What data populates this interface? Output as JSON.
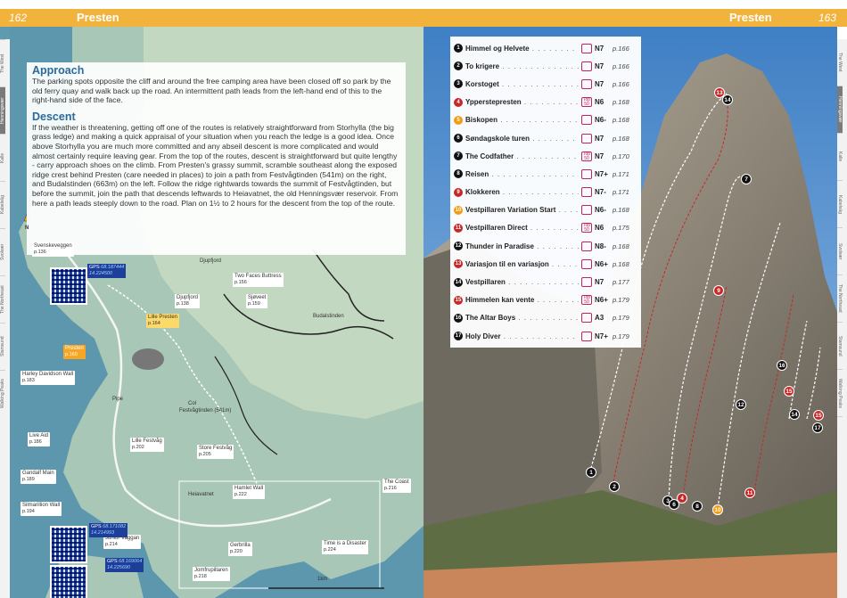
{
  "left": {
    "page_number": "162",
    "title": "Presten",
    "side_tabs": [
      "The West",
      "Henningsvær",
      "Kalle",
      "Kabelvåg",
      "Svolvær",
      "The Northeast",
      "Stamsund",
      "Walking Peaks"
    ],
    "active_tab": 1,
    "approach_heading": "Approach",
    "approach_text": "The parking spots opposite the cliff and around the free camping area have been closed off so park by the old ferry quay and walk back up the road. An intermittent path leads from the left-hand end of this to the right-hand side of the face.",
    "descent_heading": "Descent",
    "descent_text": "If the weather is threatening, getting off one of the routes is relatively straightforward from Storhylla (the big grass ledge) and making a quick appraisal of your situation when you reach the ledge is a good idea. Once above Storhylla you are much more committed and any abseil descent is more complicated and would almost certainly require leaving gear. From the top of the routes, descent is straightforward but quite lengthy - carry approach shoes on the climb. From Presten's grassy summit, scramble southeast along the exposed ridge crest behind Presten (care needed in places) to join a path from Festvågtinden (541m) on the right, and Budalstinden (663m) on the left. Follow the ridge rightwards towards the summit of Festvågtinden, but before the summit, join the path that descends leftwards to Heiavatnet, the old Henningsvær reservoir. From here a path leads steeply down to the road. Plan on 1½ to 2 hours for the descent from the top of the route.",
    "north": "N",
    "map_labels": [
      {
        "name": "Svenskeveggen",
        "page": "p.136"
      },
      {
        "name": "Two Faces Buttress",
        "page": "p.156"
      },
      {
        "name": "Sjøveet",
        "page": "p.159"
      },
      {
        "name": "Djupfjord",
        "page": "p.138"
      },
      {
        "name": "Lille Presten",
        "page": "p.164"
      },
      {
        "name": "Presten",
        "page": "p.160"
      },
      {
        "name": "Harley Davidson Wall",
        "page": "p.183"
      },
      {
        "name": "Live Aid",
        "page": "p.186"
      },
      {
        "name": "Lille Festvåg",
        "page": "p.202"
      },
      {
        "name": "Store Festvåg",
        "page": "p.205"
      },
      {
        "name": "Gandalf Main",
        "page": "p.189"
      },
      {
        "name": "Silmarillion Wall",
        "page": "p.194"
      },
      {
        "name": "Hamlet Wall",
        "page": "p.222"
      },
      {
        "name": "The Coast",
        "page": "p.216"
      },
      {
        "name": "Junior Vaggan",
        "page": "p.214"
      },
      {
        "name": "Gerbrilla",
        "page": "p.220"
      },
      {
        "name": "Jomfrupillaren",
        "page": "p.218"
      },
      {
        "name": "Time is a Disaster",
        "page": "p.224"
      }
    ],
    "plain_labels": [
      "Budalstinden",
      "Djupfjord",
      "Col",
      "Festvågtinden (541m)",
      "Pipe",
      "Heiavatnet"
    ],
    "gps": [
      {
        "label": "GPS",
        "lat": "68.187444",
        "lon": "14.224500"
      },
      {
        "label": "GPS",
        "lat": "68.171082",
        "lon": "14.214993"
      },
      {
        "label": "GPS",
        "lat": "68.169064",
        "lon": "14.225690"
      }
    ],
    "scale": "1km"
  },
  "right": {
    "page_number": "163",
    "title": "Presten",
    "side_tabs": [
      "The West",
      "Henningsvær",
      "Kalle",
      "Kabelvåg",
      "Svolvær",
      "The Northeast",
      "Stamsund",
      "Walking Peaks"
    ],
    "active_tab": 1,
    "routes": [
      {
        "num": "1",
        "name": "Himmel og Helvete",
        "grade": "N7",
        "page": "p.166",
        "color": "#111111",
        "top50": false
      },
      {
        "num": "2",
        "name": "To krigere",
        "grade": "N7",
        "page": "p.166",
        "color": "#111111",
        "top50": false
      },
      {
        "num": "3",
        "name": "Korstoget",
        "grade": "N7",
        "page": "p.166",
        "color": "#111111",
        "top50": false
      },
      {
        "num": "4",
        "name": "Ypperstepresten",
        "grade": "N6",
        "page": "p.168",
        "color": "#c62828",
        "top50": true
      },
      {
        "num": "5",
        "name": "Biskopen",
        "grade": "N6-",
        "page": "p.168",
        "color": "#f39c12",
        "top50": false
      },
      {
        "num": "6",
        "name": "Søndagskole turen",
        "grade": "N7",
        "page": "p.168",
        "color": "#111111",
        "top50": false
      },
      {
        "num": "7",
        "name": "The Codfather",
        "grade": "N7",
        "page": "p.170",
        "color": "#111111",
        "top50": true
      },
      {
        "num": "8",
        "name": "Reisen",
        "grade": "N7+",
        "page": "p.171",
        "color": "#111111",
        "top50": false
      },
      {
        "num": "9",
        "name": "Klokkeren",
        "grade": "N7-",
        "page": "p.171",
        "color": "#c62828",
        "top50": false
      },
      {
        "num": "10",
        "name": "Vestpillaren Variation Start",
        "grade": "N6-",
        "page": "p.168",
        "color": "#f39c12",
        "top50": false
      },
      {
        "num": "11",
        "name": "Vestpillaren Direct",
        "grade": "N6",
        "page": "p.175",
        "color": "#c62828",
        "top50": true
      },
      {
        "num": "12",
        "name": "Thunder in Paradise",
        "grade": "N8-",
        "page": "p.168",
        "color": "#111111",
        "top50": false
      },
      {
        "num": "13",
        "name": "Variasjon til en variasjon",
        "grade": "N6+",
        "page": "p.168",
        "color": "#c62828",
        "top50": false
      },
      {
        "num": "14",
        "name": "Vestpillaren",
        "grade": "N7",
        "page": "p.177",
        "color": "#111111",
        "top50": false
      },
      {
        "num": "15",
        "name": "Himmelen kan vente",
        "grade": "N6+",
        "page": "p.179",
        "color": "#c62828",
        "top50": true
      },
      {
        "num": "16",
        "name": "The Altar Boys",
        "grade": "A3",
        "page": "p.179",
        "color": "#111111",
        "top50": false
      },
      {
        "num": "17",
        "name": "Holy Diver",
        "grade": "N7+",
        "page": "p.179",
        "color": "#111111",
        "top50": false
      }
    ],
    "top50_label": "Top 50"
  }
}
